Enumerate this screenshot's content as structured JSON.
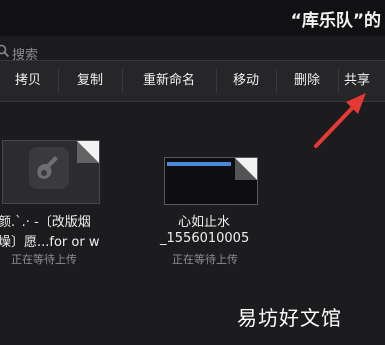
{
  "header": {
    "title": "“库乐队”的"
  },
  "search": {
    "placeholder": "搜索"
  },
  "context_menu": {
    "items": [
      {
        "label": "拷贝"
      },
      {
        "label": "复制"
      },
      {
        "label": "重新命名"
      },
      {
        "label": "移动"
      },
      {
        "label": "删除"
      },
      {
        "label": "共享"
      }
    ]
  },
  "files": [
    {
      "name_line1": "颜.`.· -〔改版烟",
      "name_line2": "燥〕愿...for or w",
      "status": "正在等待上传",
      "icon": "garageband-icon"
    },
    {
      "name_line1": "心如止水",
      "name_line2": "_1556010005",
      "status": "正在等待上传",
      "icon": "audio-file-icon"
    }
  ],
  "watermark": "易坊好文馆",
  "colors": {
    "background": "#1c1c1e",
    "menu": "#262628",
    "arrow": "#e53935",
    "accent": "#4a8ad8"
  }
}
